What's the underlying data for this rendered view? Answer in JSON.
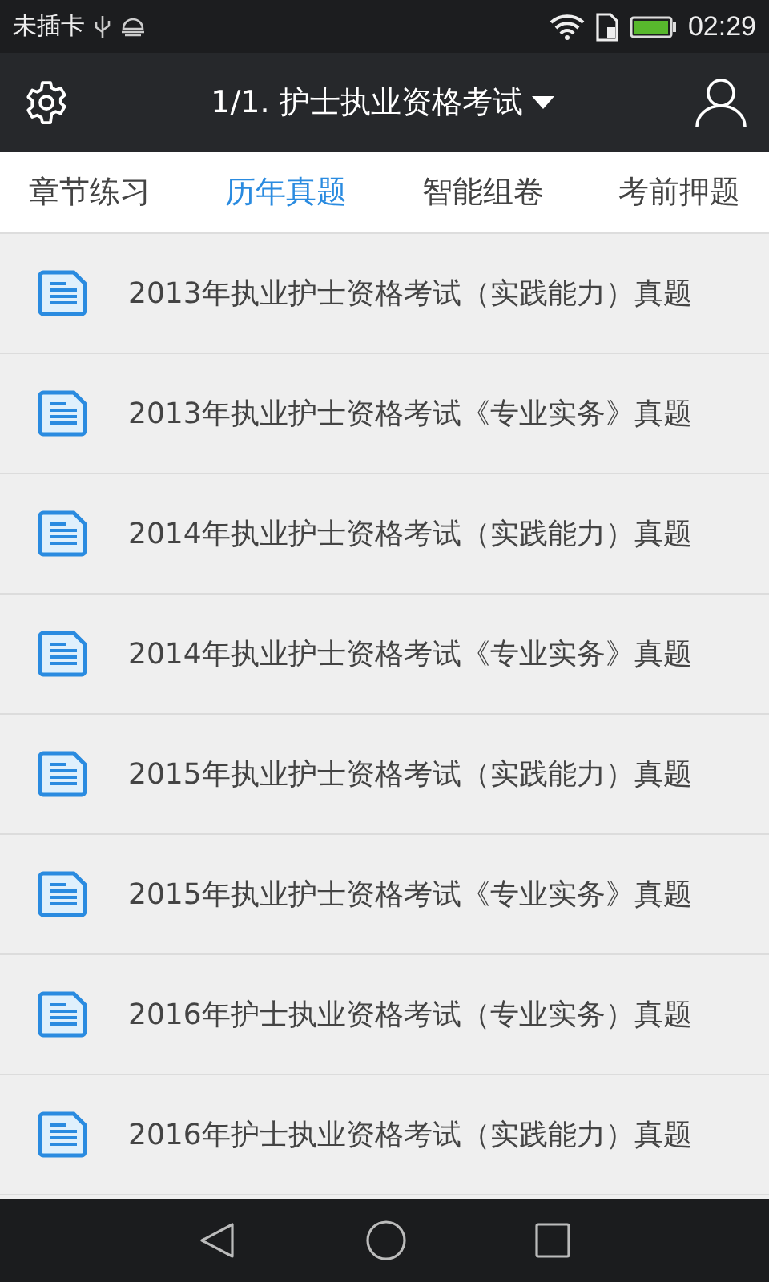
{
  "status_bar": {
    "carrier": "未插卡",
    "time": "02:29"
  },
  "app_bar": {
    "title": "1/1. 护士执业资格考试"
  },
  "tabs": [
    {
      "label": "章节练习",
      "selected": false
    },
    {
      "label": "历年真题",
      "selected": true
    },
    {
      "label": "智能组卷",
      "selected": false
    },
    {
      "label": "考前押题",
      "selected": false
    }
  ],
  "papers": [
    {
      "title": "2013年执业护士资格考试（实践能力）真题"
    },
    {
      "title": "2013年执业护士资格考试《专业实务》真题"
    },
    {
      "title": "2014年执业护士资格考试（实践能力）真题"
    },
    {
      "title": "2014年执业护士资格考试《专业实务》真题"
    },
    {
      "title": "2015年执业护士资格考试（实践能力）真题"
    },
    {
      "title": "2015年执业护士资格考试《专业实务》真题"
    },
    {
      "title": "2016年护士执业资格考试（专业实务）真题"
    },
    {
      "title": "2016年护士执业资格考试（实践能力）真题"
    }
  ]
}
